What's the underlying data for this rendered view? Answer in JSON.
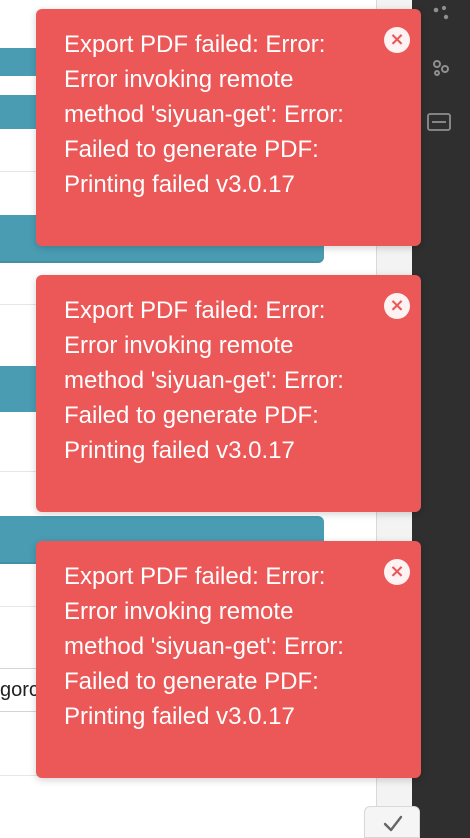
{
  "panel": {
    "button_1_label": "",
    "button_2_label": "",
    "input_fragment": "gorc"
  },
  "dock": {
    "icons": [
      "dots-icon",
      "graph-icon",
      "ocr-icon"
    ]
  },
  "notifications": [
    {
      "message": "Export PDF failed: Error: Error invoking remote method 'siyuan-get': Error: Failed to generate PDF: Printing failed v3.0.17",
      "close_icon": "×"
    },
    {
      "message": "Export PDF failed: Error: Error invoking remote method 'siyuan-get': Error: Failed to generate PDF: Printing failed v3.0.17",
      "close_icon": "×"
    },
    {
      "message": "Export PDF failed: Error: Error invoking remote method 'siyuan-get': Error: Failed to generate PDF: Printing failed v3.0.17",
      "close_icon": "×"
    }
  ],
  "confirm": {
    "icon": "check-icon"
  },
  "colors": {
    "toast_bg": "#ec5757",
    "panel_accent": "#4a9cb3",
    "dock_bg": "#2f2f2f"
  }
}
